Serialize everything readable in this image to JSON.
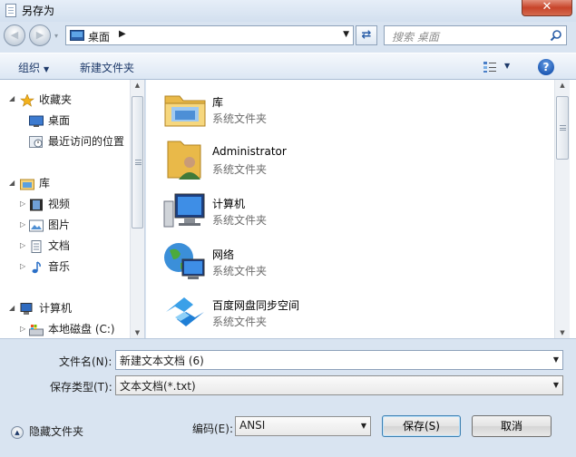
{
  "window": {
    "title": "另存为",
    "close_glyph": "✕"
  },
  "nav": {
    "back_glyph": "◀",
    "forward_glyph": "▶",
    "drop_glyph": "▾"
  },
  "address": {
    "location": "桌面",
    "separator": "▶",
    "dropdown_glyph": "▼",
    "refresh_glyph": "⇄"
  },
  "search": {
    "placeholder": "搜索 桌面"
  },
  "toolbar": {
    "organize_label": "组织",
    "organize_arrow": "▼",
    "new_folder_label": "新建文件夹",
    "view_dd": "▼",
    "help_glyph": "?"
  },
  "sidebar": {
    "favorites": {
      "label": "收藏夹",
      "children": [
        "桌面",
        "最近访问的位置"
      ]
    },
    "libraries": {
      "label": "库",
      "children": [
        "视频",
        "图片",
        "文档",
        "音乐"
      ]
    },
    "computer": {
      "label": "计算机",
      "children": [
        "本地磁盘 (C:)"
      ]
    },
    "expanded_glyph": "◢",
    "collapsed_glyph": "▷"
  },
  "scroll": {
    "up": "▲",
    "down": "▼"
  },
  "files": [
    {
      "name": "库",
      "type": "系统文件夹",
      "icon": "library-folder-icon"
    },
    {
      "name": "Administrator",
      "type": "系统文件夹",
      "icon": "user-folder-icon"
    },
    {
      "name": "计算机",
      "type": "系统文件夹",
      "icon": "computer-icon"
    },
    {
      "name": "网络",
      "type": "系统文件夹",
      "icon": "network-icon"
    },
    {
      "name": "百度网盘同步空间",
      "type": "系统文件夹",
      "icon": "baidu-netdisk-icon"
    }
  ],
  "form": {
    "filename_label": "文件名(N):",
    "filename_value": "新建文本文档 (6)",
    "filetype_label": "保存类型(T):",
    "filetype_value": "文本文档(*.txt)",
    "encoding_label": "编码(E):",
    "encoding_value": "ANSI",
    "save_label": "保存(S)",
    "cancel_label": "取消",
    "hide_folders_label": "隐藏文件夹",
    "hide_glyph": "▲",
    "dd_glyph": "▼"
  },
  "colors": {
    "frame": "#d9e4f1",
    "accent": "#1f5bb5",
    "close": "#c7442a"
  }
}
